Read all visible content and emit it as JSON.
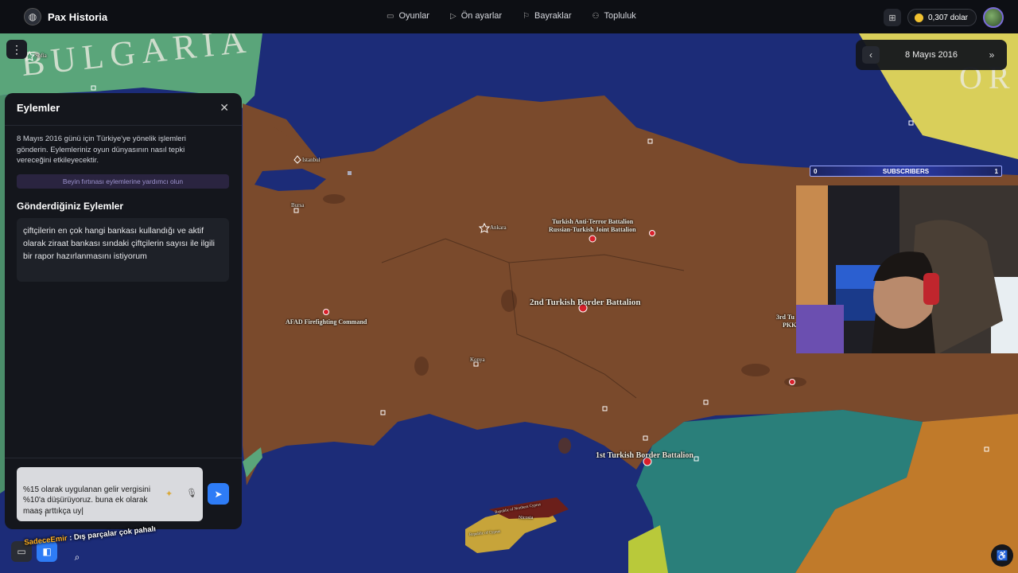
{
  "app": {
    "brand": "Pax Historia"
  },
  "nav": {
    "items": [
      {
        "label": "Oyunlar",
        "icon": "gamepad-icon"
      },
      {
        "label": "Ön ayarlar",
        "icon": "play-icon"
      },
      {
        "label": "Bayraklar",
        "icon": "flag-icon"
      },
      {
        "label": "Topluluk",
        "icon": "people-icon"
      }
    ]
  },
  "topbar": {
    "balance": "0,307 dolar"
  },
  "date_widget": {
    "date": "8 Mayıs 2016"
  },
  "actions_panel": {
    "title": "Eylemler",
    "description": "8 Mayıs 2016 günü için Türkiye'ye yönelik işlemleri gönderin. Eylemleriniz oyun dünyasının nasıl tepki vereceğini etkileyecektir.",
    "brainstorm_button": "Beyin fırtınası eylemlerine yardımcı olun",
    "sent_actions_title": "Gönderdiğiniz Eylemler",
    "sent_actions": [
      "çiftçilerin en çok hangi bankası kullandığı ve aktif olarak ziraat bankası sındaki çiftçilerin sayısı ile ilgili bir rapor hazırlanmasını istiyorum"
    ],
    "compose_text": "%15 olarak uygulanan gelir vergisini %10'a düşürüyoruz. buna ek olarak maaş arttıkça uy|"
  },
  "chat": {
    "user": "SadeceEmir",
    "message": ": Dış parçalar çok pahalı"
  },
  "map": {
    "country_label": "BULGARIA",
    "country_label_right": "OR",
    "cities": [
      "Sofia",
      "Istanbul",
      "Bursa",
      "Ankara",
      "Konya"
    ],
    "units": [
      "Turkish Anti-Terror Battalion",
      "Russian-Turkish Joint Battalion",
      "2nd Turkish Border Battalion",
      "AFAD Firefighting Command",
      "1st Turkish Border Battalion",
      "3rd Tu",
      "PKK",
      "Republic of Northern Cyprus",
      "Republic of Cyprus",
      "Nicosia"
    ]
  },
  "overlay": {
    "subscribers_label": "SUBSCRIBERS",
    "subscribers_left": "0",
    "subscribers_right": "1"
  },
  "colors": {
    "turkey": "#7a4a2c",
    "sea": "#1a2a72",
    "accent_blue": "#2e7cf6",
    "syria": "#2a7f7a",
    "cyprus": "#c7a43a"
  }
}
